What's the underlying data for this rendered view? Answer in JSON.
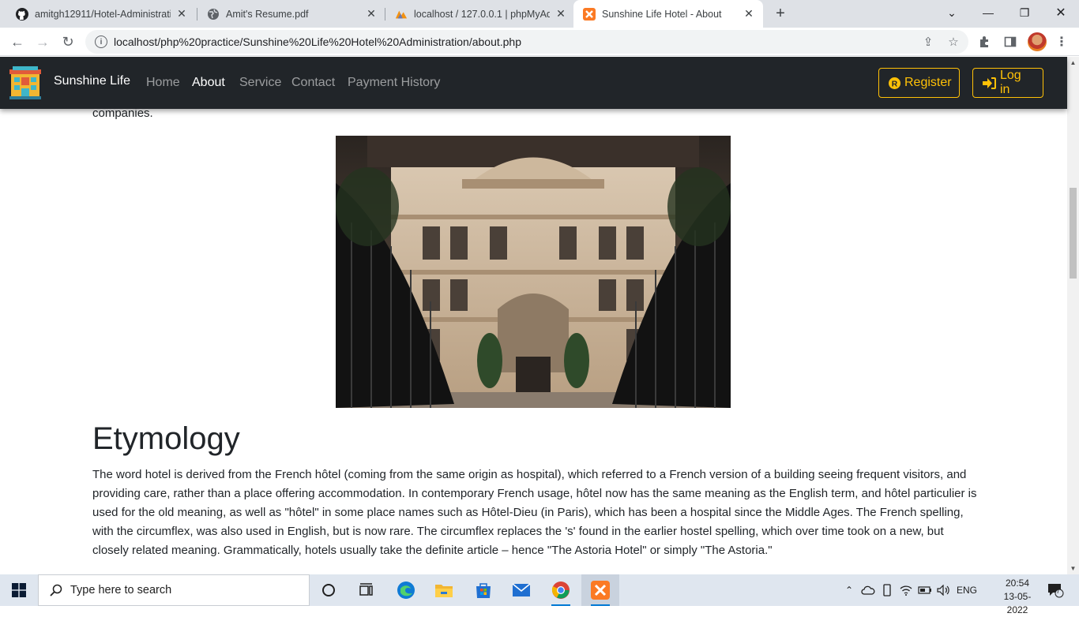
{
  "browser": {
    "tabs": [
      {
        "title": "amitgh12911/Hotel-Administrati",
        "icon": "github-icon",
        "active": false
      },
      {
        "title": "Amit's Resume.pdf",
        "icon": "globe-icon",
        "active": false
      },
      {
        "title": "localhost / 127.0.0.1 | phpMyAdm",
        "icon": "phpmyadmin-icon",
        "active": false
      },
      {
        "title": "Sunshine Life Hotel - About",
        "icon": "xampp-icon",
        "active": true
      }
    ],
    "url": "localhost/php%20practice/Sunshine%20Life%20Hotel%20Administration/about.php"
  },
  "site": {
    "brand": "Sunshine Life",
    "nav": {
      "home": "Home",
      "about": "About",
      "service": "Service",
      "contact": "Contact",
      "payment_history": "Payment History"
    },
    "register_label": "Register",
    "login_label": "Log in",
    "accent_color": "#ffc107"
  },
  "page": {
    "previous_text_tail": "companies.",
    "heading": "Etymology",
    "paragraph": "The word hotel is derived from the French hôtel (coming from the same origin as hospital), which referred to a French version of a building seeing frequent visitors, and providing care, rather than a place offering accommodation. In contemporary French usage, hôtel now has the same meaning as the English term, and hôtel particulier is used for the old meaning, as well as \"hôtel\" in some place names such as Hôtel-Dieu (in Paris), which has been a hospital since the Middle Ages. The French spelling, with the circumflex, was also used in English, but is now rare. The circumflex replaces the 's' found in the earlier hostel spelling, which over time took on a new, but closely related meaning. Grammatically, hotels usually take the definite article – hence \"The Astoria Hotel\" or simply \"The Astoria.\""
  },
  "taskbar": {
    "search_placeholder": "Type here to search",
    "language": "ENG",
    "time": "20:54",
    "date": "13-05-2022",
    "notification_count": "7"
  }
}
